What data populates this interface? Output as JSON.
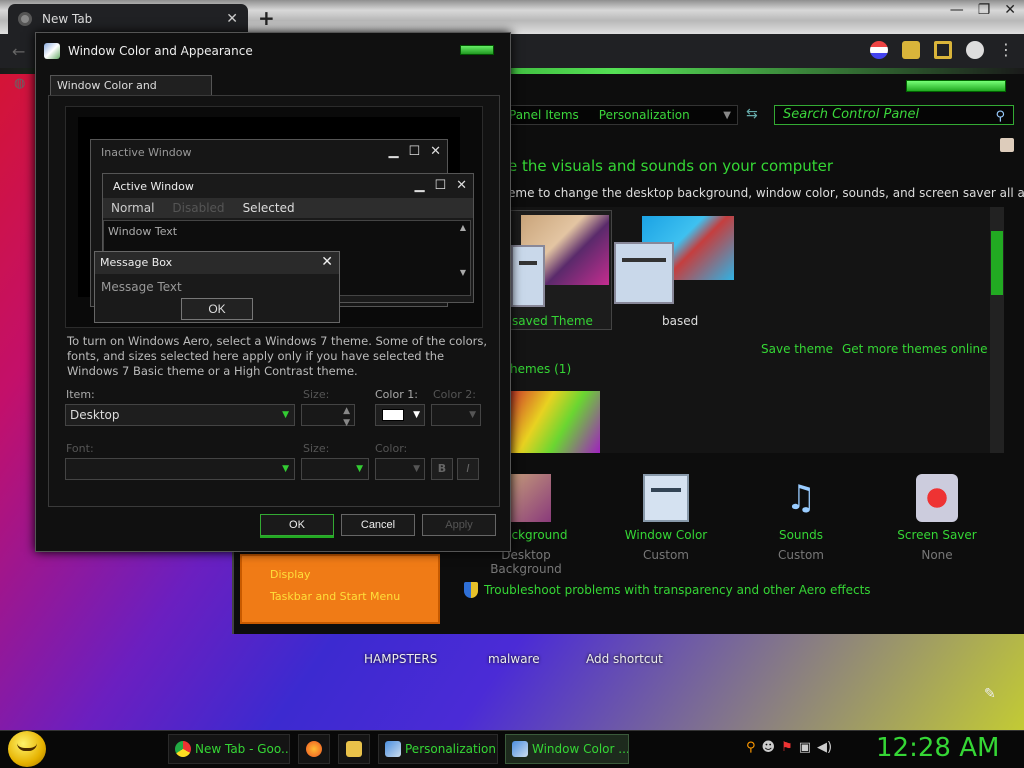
{
  "browser": {
    "tab_title": "New Tab",
    "tab_close": "✕",
    "new_tab": "+",
    "window_controls": [
      "—",
      "❐",
      "✕"
    ]
  },
  "control_panel": {
    "address_items": [
      "Panel Items",
      "Personalization"
    ],
    "search_placeholder": "Search Control Panel",
    "heading": "e the visuals and sounds on your computer",
    "subtext": "eme to change the desktop background, window color, sounds, and screen saver all at once.",
    "theme_saved_label": "saved Theme",
    "theme_based_label": "based",
    "save_theme": "Save theme",
    "more_themes": "Get more themes online",
    "themes_count": "hemes (1)",
    "items": [
      {
        "label": "p Background",
        "sub": "Desktop Background"
      },
      {
        "label": "Window Color",
        "sub": "Custom"
      },
      {
        "label": "Sounds",
        "sub": "Custom"
      },
      {
        "label": "Screen Saver",
        "sub": "None"
      }
    ],
    "troubleshoot": "Troubleshoot problems with transparency and other Aero effects"
  },
  "orange_panel": {
    "display": "Display",
    "taskbar": "Taskbar and Start Menu"
  },
  "shortcuts": [
    "HAMPSTERS",
    "malware",
    "Add shortcut"
  ],
  "dialog": {
    "title": "Window Color and Appearance",
    "tab": "Window Color and Appearance",
    "preview": {
      "inactive_title": "Inactive Window",
      "active_title": "Active Window",
      "state_normal": "Normal",
      "state_disabled": "Disabled",
      "state_selected": "Selected",
      "window_text": "Window Text",
      "msgbox_title": "Message Box",
      "msgbox_text": "Message Text",
      "msgbox_ok": "OK"
    },
    "info_text": "To turn on Windows Aero, select a Windows 7 theme.  Some of the colors, fonts, and sizes selected here apply only if you have selected the Windows 7 Basic theme or a High Contrast theme.",
    "labels": {
      "item": "Item:",
      "size": "Size:",
      "color1": "Color 1:",
      "color2": "Color 2:",
      "font": "Font:",
      "font_size": "Size:",
      "color": "Color:",
      "bold": "B",
      "italic": "I"
    },
    "item_value": "Desktop",
    "buttons": {
      "ok": "OK",
      "cancel": "Cancel",
      "apply": "Apply"
    }
  },
  "taskbar": {
    "buttons": [
      "New Tab - Goo...",
      "Personalization",
      "Window Color ..."
    ],
    "clock": "12:28 AM"
  }
}
